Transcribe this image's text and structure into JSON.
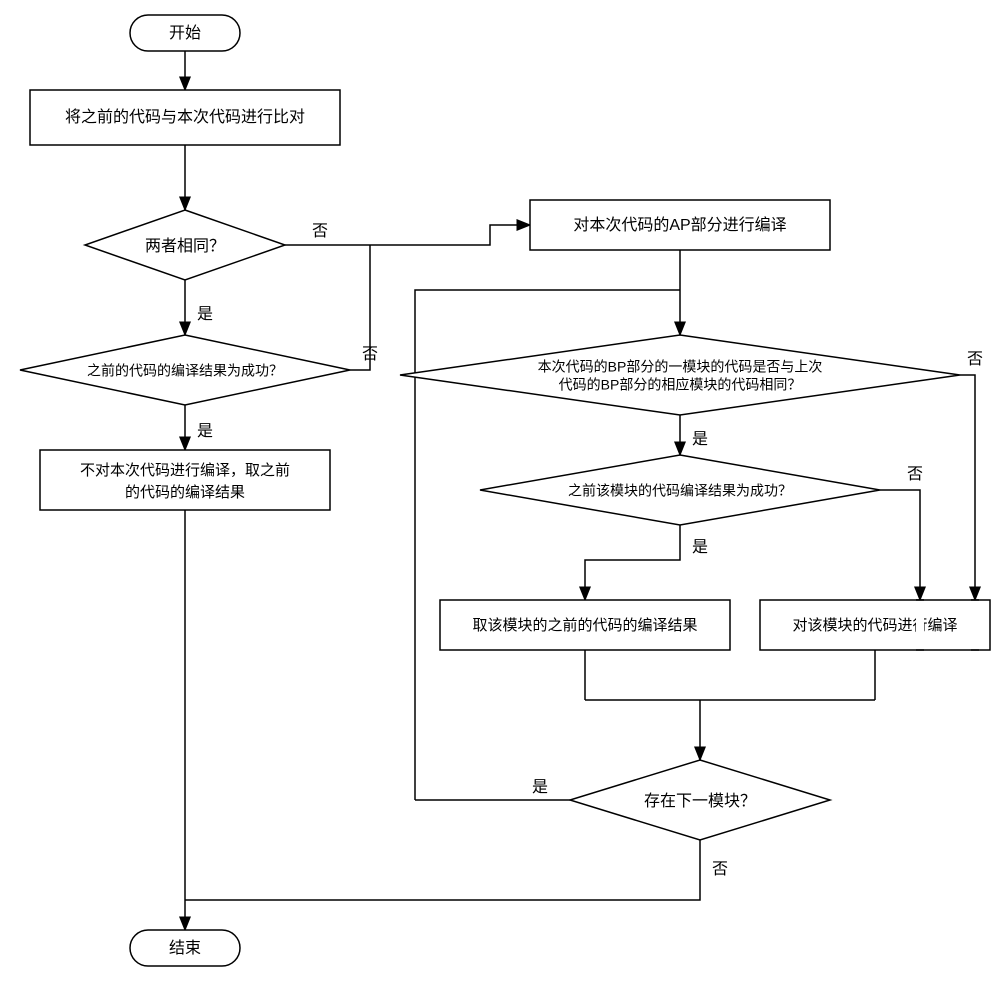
{
  "nodes": {
    "start": "开始",
    "compare": "将之前的代码与本次代码进行比对",
    "d_same": "两者相同？",
    "d_prev_success": "之前的代码的编译结果为成功？",
    "skip_compile": "不对本次代码进行编译，取之前\n的代码的编译结果",
    "compile_ap": "对本次代码的AP部分进行编译",
    "d_bp_same": "本次代码的BP部分的一模块的代码是否与上次\n代码的BP部分的相应模块的代码相同？",
    "d_mod_success": "之前该模块的代码编译结果为成功？",
    "take_prev_mod": "取该模块的之前的代码的编译结果",
    "compile_mod": "对该模块的代码进行编译",
    "d_next_mod": "存在下一模块？",
    "end": "结束"
  },
  "edges": {
    "yes": "是",
    "no": "否"
  }
}
